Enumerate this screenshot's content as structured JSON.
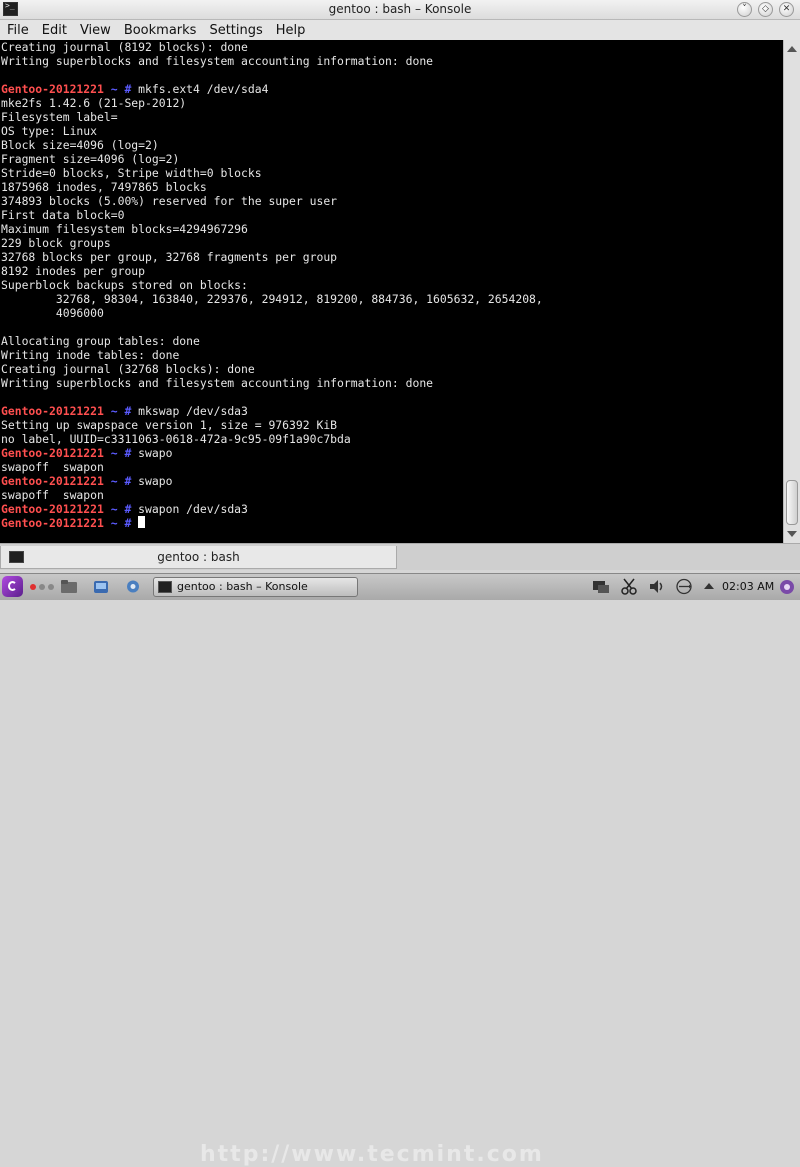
{
  "window": {
    "title": "gentoo : bash – Konsole"
  },
  "menu": [
    "File",
    "Edit",
    "View",
    "Bookmarks",
    "Settings",
    "Help"
  ],
  "terminal": {
    "lines": [
      {
        "text": "Creating journal (8192 blocks): done"
      },
      {
        "text": "Writing superblocks and filesystem accounting information: done"
      },
      {
        "text": ""
      },
      {
        "prompt": "Gentoo-20121221",
        "sep": " ~ # ",
        "text": "mkfs.ext4 /dev/sda4"
      },
      {
        "text": "mke2fs 1.42.6 (21-Sep-2012)"
      },
      {
        "text": "Filesystem label="
      },
      {
        "text": "OS type: Linux"
      },
      {
        "text": "Block size=4096 (log=2)"
      },
      {
        "text": "Fragment size=4096 (log=2)"
      },
      {
        "text": "Stride=0 blocks, Stripe width=0 blocks"
      },
      {
        "text": "1875968 inodes, 7497865 blocks"
      },
      {
        "text": "374893 blocks (5.00%) reserved for the super user"
      },
      {
        "text": "First data block=0"
      },
      {
        "text": "Maximum filesystem blocks=4294967296"
      },
      {
        "text": "229 block groups"
      },
      {
        "text": "32768 blocks per group, 32768 fragments per group"
      },
      {
        "text": "8192 inodes per group"
      },
      {
        "text": "Superblock backups stored on blocks:"
      },
      {
        "text": "        32768, 98304, 163840, 229376, 294912, 819200, 884736, 1605632, 2654208,"
      },
      {
        "text": "        4096000"
      },
      {
        "text": ""
      },
      {
        "text": "Allocating group tables: done"
      },
      {
        "text": "Writing inode tables: done"
      },
      {
        "text": "Creating journal (32768 blocks): done"
      },
      {
        "text": "Writing superblocks and filesystem accounting information: done"
      },
      {
        "text": ""
      },
      {
        "prompt": "Gentoo-20121221",
        "sep": " ~ # ",
        "text": "mkswap /dev/sda3"
      },
      {
        "text": "Setting up swapspace version 1, size = 976392 KiB"
      },
      {
        "text": "no label, UUID=c3311063-0618-472a-9c95-09f1a90c7bda"
      },
      {
        "prompt": "Gentoo-20121221",
        "sep": " ~ # ",
        "text": "swapo"
      },
      {
        "text": "swapoff  swapon"
      },
      {
        "prompt": "Gentoo-20121221",
        "sep": " ~ # ",
        "text": "swapo"
      },
      {
        "text": "swapoff  swapon"
      },
      {
        "prompt": "Gentoo-20121221",
        "sep": " ~ # ",
        "text": "swapon /dev/sda3"
      },
      {
        "prompt": "Gentoo-20121221",
        "sep": " ~ # ",
        "text": "",
        "cursor": true
      }
    ]
  },
  "tab": {
    "label": "gentoo : bash"
  },
  "taskbar": {
    "task_label": "gentoo : bash – Konsole",
    "clock": "02:03 AM",
    "watermark": "http://www.tecmint.com",
    "dot_colors": [
      "#e03030",
      "#888888",
      "#888888"
    ]
  },
  "colors": {
    "prompt_host": "#ff4f4f",
    "prompt_sep": "#5b5bff",
    "terminal_bg": "#000000"
  }
}
